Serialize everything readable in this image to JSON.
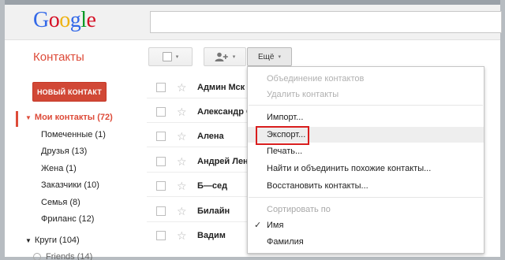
{
  "logo": {
    "letters": [
      "G",
      "o",
      "o",
      "g",
      "l",
      "e"
    ],
    "colors": [
      "#3369e8",
      "#d50f25",
      "#eeb211",
      "#3369e8",
      "#009925",
      "#d50f25"
    ]
  },
  "search": {
    "value": "",
    "placeholder": ""
  },
  "app_title": "Контакты",
  "toolbar": {
    "select_caret": "▾",
    "add_caret": "▾",
    "more_label": "Ещё",
    "more_caret": "▾"
  },
  "new_contact_label": "НОВЫЙ КОНТАКТ",
  "sidebar": {
    "my_contacts": "Мои контакты (72)",
    "groups": [
      "Помеченные (1)",
      "Друзья (13)",
      "Жена (1)",
      "Заказчики (10)",
      "Семья (8)",
      "Фриланс (12)"
    ],
    "circles": "Круги (104)",
    "friends_partial": "Friends (14)"
  },
  "contacts": [
    "Админ Мск",
    "Александр Са",
    "Алена",
    "Андрей Лени",
    "Б—сед",
    "Билайн",
    "Вадим"
  ],
  "menu": {
    "merge": "Объединение контактов",
    "delete": "Удалить контакты",
    "import": "Импорт...",
    "export": "Экспорт...",
    "print": "Печать...",
    "find_duplicates": "Найти и объединить похожие контакты...",
    "restore": "Восстановить контакты...",
    "sort_header": "Сортировать по",
    "sort_first": "Имя",
    "sort_last": "Фамилия"
  },
  "colors": {
    "accent": "#dd4b39",
    "new_contact_bg": "#d14836",
    "highlight": "#d91e1e"
  }
}
